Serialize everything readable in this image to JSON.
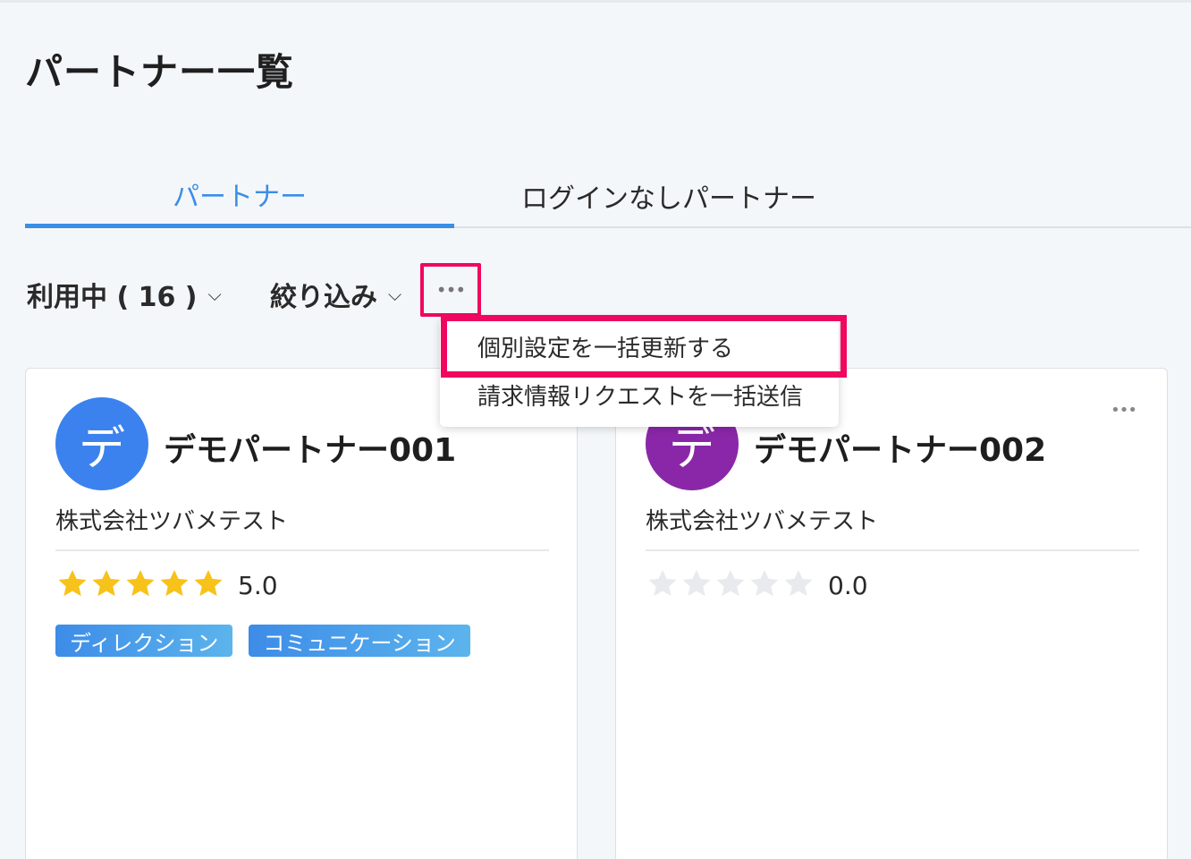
{
  "page": {
    "title": "パートナー一覧"
  },
  "tabs": [
    {
      "label": "パートナー",
      "active": true
    },
    {
      "label": "ログインなしパートナー",
      "active": false
    }
  ],
  "filters": {
    "status_label": "利用中 ( 16 )",
    "narrow_label": "絞り込み",
    "more_icon": "ellipsis-icon"
  },
  "menu": {
    "items": [
      {
        "label": "個別設定を一括更新する",
        "highlighted": true
      },
      {
        "label": "請求情報リクエストを一括送信"
      }
    ]
  },
  "partners": [
    {
      "avatar_char": "デ",
      "avatar_color": "#3b82ef",
      "name": "デモパートナー001",
      "company": "株式会社ツバメテスト",
      "rating": "5.0",
      "stars_filled": 5,
      "tags": [
        "ディレクション",
        "コミュニケーション"
      ]
    },
    {
      "avatar_char": "デ",
      "avatar_color": "#8a27a8",
      "name": "デモパートナー002",
      "company": "株式会社ツバメテスト",
      "rating": "0.0",
      "stars_filled": 0,
      "tags": []
    }
  ],
  "colors": {
    "accent": "#3b8ee6",
    "highlight": "#f0075f",
    "star_filled": "#f7c21a",
    "star_empty": "#e8eaed"
  }
}
